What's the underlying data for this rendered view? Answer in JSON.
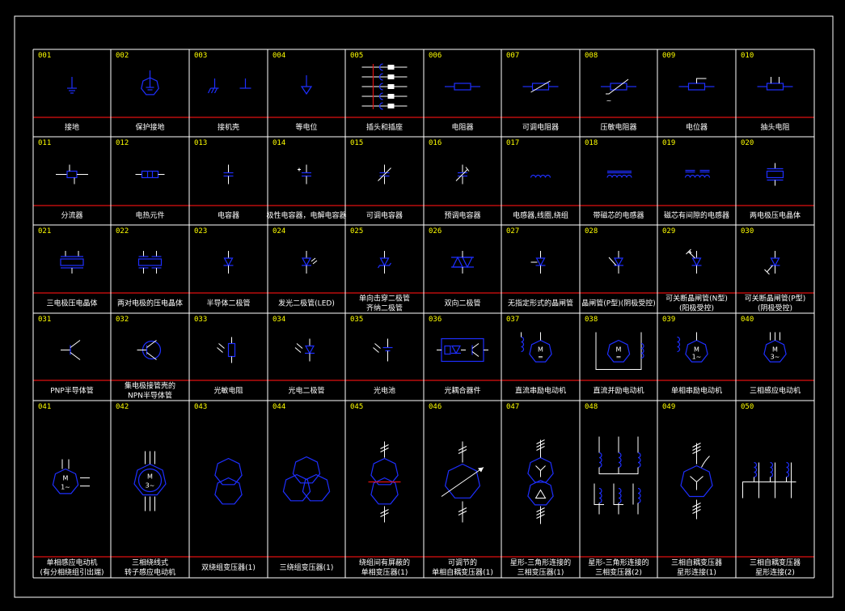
{
  "colors": {
    "background": "#000000",
    "grid": "#ffffff",
    "separator": "#e01010",
    "symbol": "#1e2fff",
    "number": "#ffff00"
  },
  "cells": [
    {
      "num": "001",
      "label": [
        "接地"
      ]
    },
    {
      "num": "002",
      "label": [
        "保护接地"
      ]
    },
    {
      "num": "003",
      "label": [
        "接机壳"
      ]
    },
    {
      "num": "004",
      "label": [
        "等电位"
      ]
    },
    {
      "num": "005",
      "label": [
        "插头和插座"
      ]
    },
    {
      "num": "006",
      "label": [
        "电阻器"
      ]
    },
    {
      "num": "007",
      "label": [
        "可调电阻器"
      ]
    },
    {
      "num": "008",
      "label": [
        "压敏电阻器"
      ]
    },
    {
      "num": "009",
      "label": [
        "电位器"
      ]
    },
    {
      "num": "010",
      "label": [
        "抽头电阻"
      ]
    },
    {
      "num": "011",
      "label": [
        "分流器"
      ]
    },
    {
      "num": "012",
      "label": [
        "电热元件"
      ]
    },
    {
      "num": "013",
      "label": [
        "电容器"
      ]
    },
    {
      "num": "014",
      "label": [
        "极性电容器，电解电容器"
      ]
    },
    {
      "num": "015",
      "label": [
        "可调电容器"
      ]
    },
    {
      "num": "016",
      "label": [
        "预调电容器"
      ]
    },
    {
      "num": "017",
      "label": [
        "电感器,线圈,绕组"
      ]
    },
    {
      "num": "018",
      "label": [
        "带磁芯的电感器"
      ]
    },
    {
      "num": "019",
      "label": [
        "磁芯有间隙的电感器"
      ]
    },
    {
      "num": "020",
      "label": [
        "两电极压电晶体"
      ]
    },
    {
      "num": "021",
      "label": [
        "三电极压电晶体"
      ]
    },
    {
      "num": "022",
      "label": [
        "两对电极的压电晶体"
      ]
    },
    {
      "num": "023",
      "label": [
        "半导体二极管"
      ]
    },
    {
      "num": "024",
      "label": [
        "发光二极管(LED)"
      ]
    },
    {
      "num": "025",
      "label": [
        "单向击穿二极管",
        "齐纳二极管"
      ]
    },
    {
      "num": "026",
      "label": [
        "双向二极管"
      ]
    },
    {
      "num": "027",
      "label": [
        "无指定形式的晶闸管"
      ]
    },
    {
      "num": "028",
      "label": [
        "晶闸管(P型)(阴极受控)"
      ]
    },
    {
      "num": "029",
      "label": [
        "可关断晶闸管(N型)",
        "(阳极受控)"
      ]
    },
    {
      "num": "030",
      "label": [
        "可关断晶闸管(P型)",
        "(阴极受控)"
      ]
    },
    {
      "num": "031",
      "label": [
        "PNP半导体管"
      ]
    },
    {
      "num": "032",
      "label": [
        "集电极接管壳的",
        "NPN半导体管"
      ]
    },
    {
      "num": "033",
      "label": [
        "光敏电阻"
      ]
    },
    {
      "num": "034",
      "label": [
        "光电二极管"
      ]
    },
    {
      "num": "035",
      "label": [
        "光电池"
      ]
    },
    {
      "num": "036",
      "label": [
        "光耦合器件"
      ]
    },
    {
      "num": "037",
      "label": [
        "直流串励电动机"
      ]
    },
    {
      "num": "038",
      "label": [
        "直流并励电动机"
      ]
    },
    {
      "num": "039",
      "label": [
        "单相串励电动机"
      ]
    },
    {
      "num": "040",
      "label": [
        "三相感应电动机"
      ]
    },
    {
      "num": "041",
      "label": [
        "单相感应电动机",
        "(有分相绕组引出端)"
      ]
    },
    {
      "num": "042",
      "label": [
        "三相绕线式",
        "转子感应电动机"
      ]
    },
    {
      "num": "043",
      "label": [
        "双绕组变压器(1)"
      ]
    },
    {
      "num": "044",
      "label": [
        "三绕组变压器(1)"
      ]
    },
    {
      "num": "045",
      "label": [
        "绕组间有屏蔽的",
        "单相变压器(1)"
      ]
    },
    {
      "num": "046",
      "label": [
        "可调节的",
        "单相自耦变压器(1)"
      ]
    },
    {
      "num": "047",
      "label": [
        "星形-三角形连接的",
        "三相变压器(1)"
      ]
    },
    {
      "num": "048",
      "label": [
        "星形-三角形连接的",
        "三相变压器(2)"
      ]
    },
    {
      "num": "049",
      "label": [
        "三相自耦变压器",
        "星形连接(1)"
      ]
    },
    {
      "num": "050",
      "label": [
        "三相自耦变压器",
        "星形连接(2)"
      ]
    }
  ],
  "symbol_text": {
    "m": "M",
    "m_1ph": "1~",
    "m_3ph": "3~",
    "minus_eq": "=",
    "wave": "~"
  }
}
